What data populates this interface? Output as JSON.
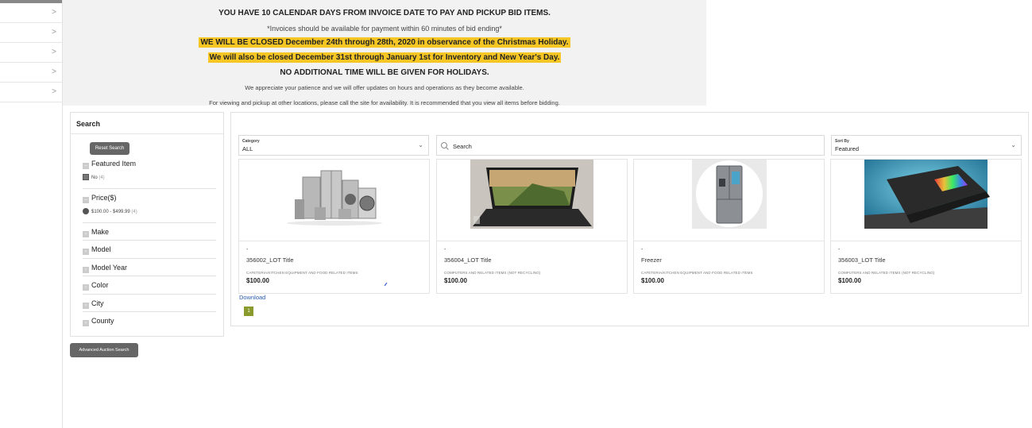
{
  "sidebar": {
    "items": [
      ">",
      ">",
      ">",
      ">",
      ">"
    ]
  },
  "banner": {
    "line1": "YOU HAVE 10 CALENDAR DAYS FROM INVOICE DATE TO PAY AND PICKUP BID ITEMS.",
    "line2": "*Invoices should be available for payment within 60 minutes of bid ending*",
    "line3": "WE WILL BE CLOSED December 24th through 28th, 2020 in observance of the Christmas Holiday.",
    "line4": "We will also be closed December 31st through January 1st for Inventory and New Year's Day.",
    "line5": "NO ADDITIONAL TIME WILL BE GIVEN FOR HOLIDAYS.",
    "line6": "We appreciate your patience and we will offer updates on hours and operations as they become available.",
    "line7": "For viewing and pickup at other locations, please call the site for availability. It is recommended that you view all items before bidding.",
    "highlight_color": "#f6c624"
  },
  "search_panel": {
    "title": "Search",
    "reset_label": "Reset Search",
    "featured": {
      "label": "Featured Item",
      "option": "No",
      "count": "(4)"
    },
    "price": {
      "label": "Price($)",
      "option": "$100.00 - $499.99",
      "count": "(4)"
    },
    "facets": [
      "Make",
      "Model",
      "Model Year",
      "Color",
      "City",
      "County"
    ],
    "advanced_label": "Advanced Auction Search"
  },
  "filters": {
    "category_label": "Category",
    "category_value": "ALL",
    "search_placeholder": "Search",
    "sort_label": "Sort By",
    "sort_value": "Featured"
  },
  "items": [
    {
      "dash": "-",
      "title": "356002_LOT Title",
      "category": "CAFETERIA/KITCHEN EQUIPMENT AND FOOD RELATED ITEMS",
      "price": "$100.00",
      "image": "appliances"
    },
    {
      "dash": "-",
      "title": "356004_LOT Title",
      "category": "COMPUTERS AND RELATED ITEMS (NOT RECYCLING)",
      "price": "$100.00",
      "image": "laptop-landscape"
    },
    {
      "dash": "-",
      "title": "Freezer",
      "category": "CAFETERIA/KITCHEN EQUIPMENT AND FOOD RELATED ITEMS",
      "price": "$100.00",
      "image": "refrigerator"
    },
    {
      "dash": "-",
      "title": "356003_LOT Title",
      "category": "COMPUTERS AND RELATED ITEMS (NOT RECYCLING)",
      "price": "$100.00",
      "image": "laptop-rainbow"
    }
  ],
  "download_label": "Download",
  "pagination": {
    "current": "1",
    "color": "#8a9a2c"
  }
}
